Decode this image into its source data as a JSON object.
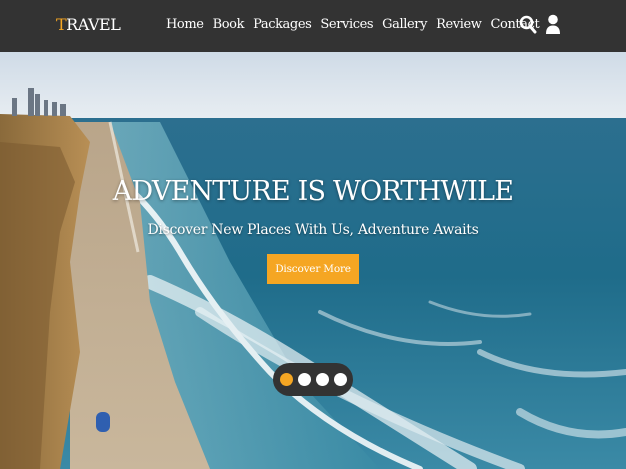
{
  "brand": {
    "first_letter": "T",
    "rest": "RAVEL"
  },
  "nav": {
    "items": [
      {
        "label": "Home"
      },
      {
        "label": "Book"
      },
      {
        "label": "Packages"
      },
      {
        "label": "Services"
      },
      {
        "label": "Gallery"
      },
      {
        "label": "Review"
      },
      {
        "label": "Contact"
      }
    ],
    "icons": [
      "search-icon",
      "user-icon"
    ]
  },
  "hero": {
    "headline": "ADVENTURE IS WORTHWILE",
    "subheadline": "Discover New Places With Us, Adventure Awaits",
    "cta_label": "Discover More",
    "slides": 4,
    "active_slide": 1
  },
  "colors": {
    "accent": "#f5a623",
    "navbar": "#333333",
    "text": "#ffffff"
  }
}
